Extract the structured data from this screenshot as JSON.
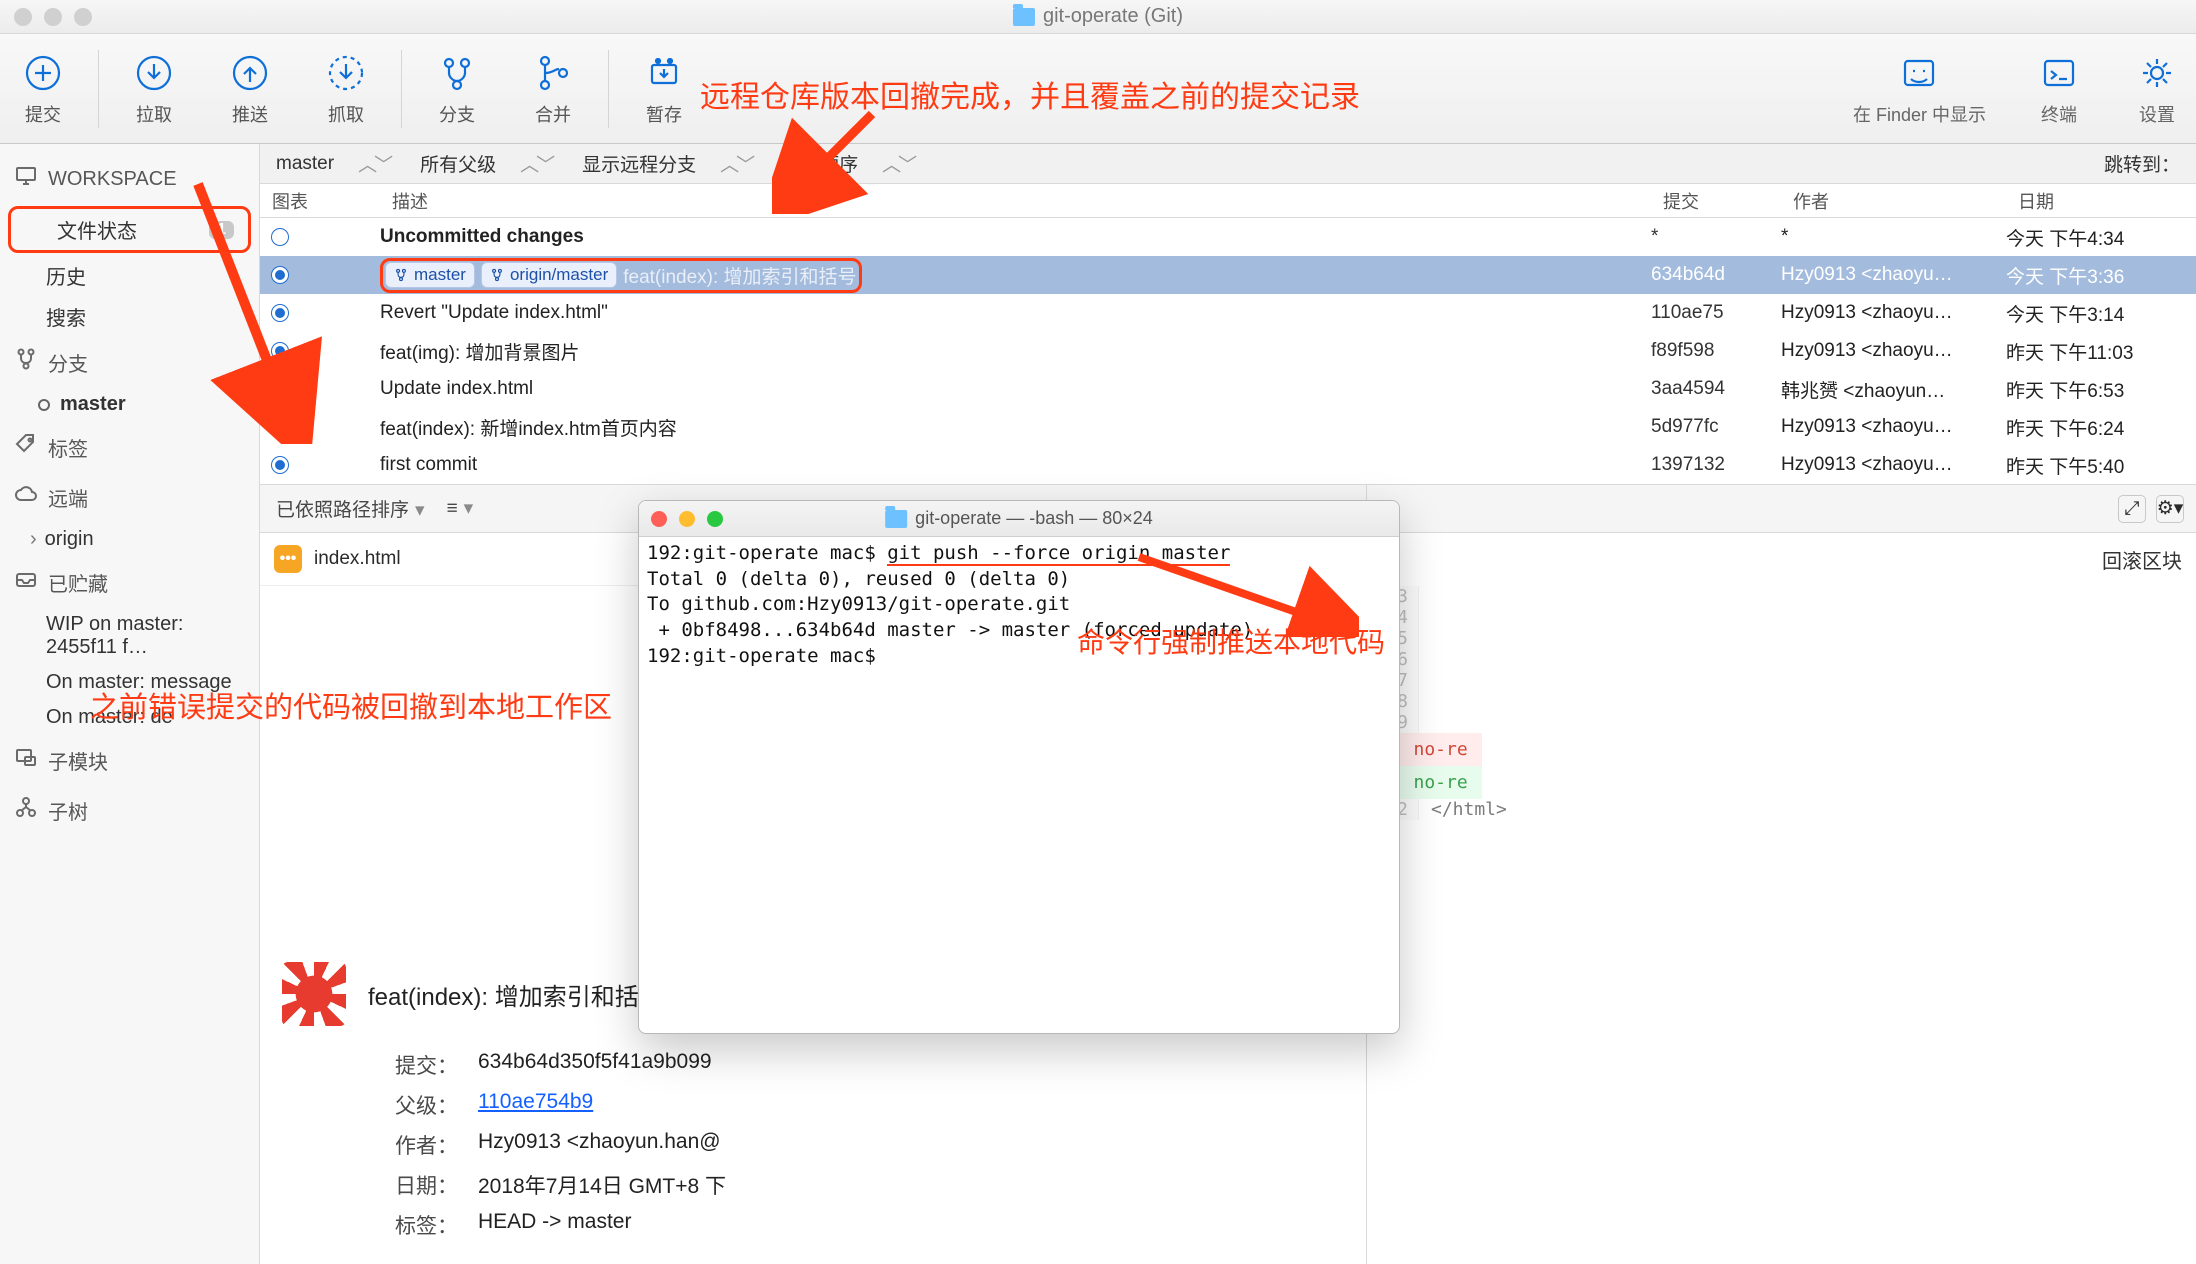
{
  "window": {
    "title": "git-operate (Git)"
  },
  "toolbar": {
    "commit": "提交",
    "pull": "拉取",
    "push": "推送",
    "fetch": "抓取",
    "branch": "分支",
    "merge": "合并",
    "stash": "暂存",
    "show_in_finder": "在 Finder 中显示",
    "terminal": "终端",
    "settings": "设置"
  },
  "annotations": {
    "top": "远程仓库版本回撤完成，并且覆盖之前的提交记录",
    "left": "之前错误提交的代码被回撤到本地工作区",
    "term": "命令行强制推送本地代码"
  },
  "sidebar": {
    "workspace": "WORKSPACE",
    "file_status": "文件状态",
    "file_status_count": "1",
    "history": "历史",
    "search": "搜索",
    "branches": "分支",
    "master": "master",
    "tags": "标签",
    "remotes": "远端",
    "origin": "origin",
    "stashes": "已贮藏",
    "stash_items": [
      "WIP on master: 2455f11 f…",
      "On master: message",
      "On master: de"
    ],
    "submodules": "子模块",
    "subtrees": "子树"
  },
  "filter": {
    "branch": "master",
    "parents": "所有父级",
    "remote": "显示远程分支",
    "order": "层级顺序",
    "jump_to": "跳转到："
  },
  "columns": {
    "graph": "图表",
    "desc": "描述",
    "commit": "提交",
    "author": "作者",
    "date": "日期"
  },
  "commits": [
    {
      "desc": "Uncommitted changes",
      "commit": "*",
      "author": "*",
      "date": "今天 下午4:34",
      "bold": true,
      "hollow": true
    },
    {
      "branches": [
        "master",
        "origin/master"
      ],
      "desc": "feat(index): 增加索引和括号",
      "commit": "634b64d",
      "author": "Hzy0913 <zhaoyu…",
      "date": "今天 下午3:36",
      "selected": true,
      "boxed": true
    },
    {
      "desc": "Revert \"Update index.html\"",
      "commit": "110ae75",
      "author": "Hzy0913 <zhaoyu…",
      "date": "今天 下午3:14"
    },
    {
      "desc": "feat(img): 增加背景图片",
      "commit": "f89f598",
      "author": "Hzy0913 <zhaoyu…",
      "date": "昨天 下午11:03"
    },
    {
      "desc": "Update index.html",
      "commit": "3aa4594",
      "author": "韩兆赟 <zhaoyun…",
      "date": "昨天 下午6:53"
    },
    {
      "desc": "feat(index): 新增index.htm首页内容",
      "commit": "5d977fc",
      "author": "Hzy0913 <zhaoyu…",
      "date": "昨天 下午6:24"
    },
    {
      "desc": "first commit",
      "commit": "1397132",
      "author": "Hzy0913 <zhaoyu…",
      "date": "昨天 下午5:40"
    }
  ],
  "pathbar": {
    "sort": "已依照路径排序",
    "list_icon": "≡"
  },
  "file_list": {
    "file": "index.html"
  },
  "commit_detail": {
    "title": "feat(index): 增加索引和括号",
    "k_commit": "提交：",
    "v_commit": "634b64d350f5f41a9b099",
    "k_parent": "父级：",
    "v_parent": "110ae754b9",
    "k_author": "作者：",
    "v_author": "Hzy0913 <zhaoyun.han@",
    "k_date": "日期：",
    "v_date": "2018年7月14日 GMT+8 下",
    "k_tags": "标签：",
    "v_tags": "HEAD -> master"
  },
  "right_panel": {
    "rollback": "回滚区块",
    "hunk_red": "t: no-re",
    "hunk_green": "t: no-re",
    "gutter": [
      "23",
      "24",
      "25",
      "26",
      "27",
      "28",
      "29",
      "",
      "",
      "",
      "",
      "32"
    ],
    "tail_code": "</html>"
  },
  "terminal": {
    "title": "git-operate — -bash — 80×24",
    "lines": [
      "192:git-operate mac$ git push --force origin master",
      "Total 0 (delta 0), reused 0 (delta 0)",
      "To github.com:Hzy0913/git-operate.git",
      " + 0bf8498...634b64d master -> master (forced update)",
      "192:git-operate mac$ "
    ]
  }
}
